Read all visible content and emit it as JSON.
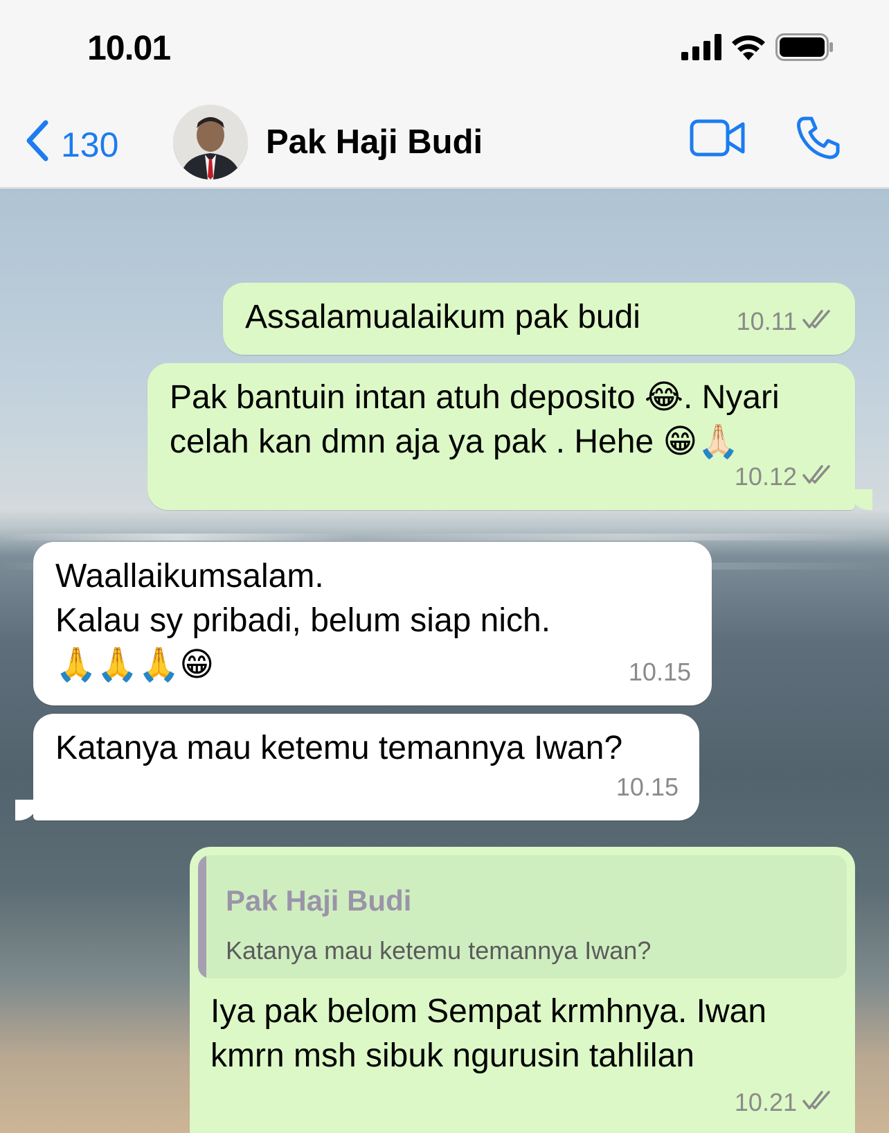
{
  "status_bar": {
    "time": "10.01",
    "icons": [
      "signal-icon",
      "wifi-icon",
      "battery-icon"
    ]
  },
  "header": {
    "back_count": "130",
    "contact_name": "Pak Haji Budi",
    "actions": [
      "video-call-icon",
      "phone-call-icon"
    ],
    "accent_color": "#1c7cf0"
  },
  "messages": [
    {
      "direction": "out",
      "text": "Assalamualaikum pak budi",
      "time": "10.11",
      "status": "read"
    },
    {
      "direction": "out",
      "line1": "Pak bantuin intan atuh deposito 😂. Nyari",
      "line2": "celah kan dmn aja ya pak . Hehe 😁🙏🏻",
      "time": "10.12",
      "status": "read"
    },
    {
      "direction": "in",
      "line1": "Waallaikumsalam.",
      "line2": "Kalau sy pribadi, belum siap nich.",
      "line3": "🙏🙏🙏😁",
      "time": "10.15"
    },
    {
      "direction": "in",
      "text": "Katanya mau ketemu temannya Iwan?",
      "time": "10.15"
    },
    {
      "direction": "out",
      "quote_author": "Pak Haji Budi",
      "quote_text": "Katanya mau ketemu temannya Iwan?",
      "line1": "Iya pak belom Sempat krmhnya. Iwan",
      "line2": "kmrn msh sibuk ngurusin tahlilan",
      "time": "10.21",
      "status": "read"
    }
  ],
  "colors": {
    "outgoing_bubble": "#dcf8c6",
    "incoming_bubble": "#ffffff",
    "quote_bar": "#a69fb3"
  }
}
